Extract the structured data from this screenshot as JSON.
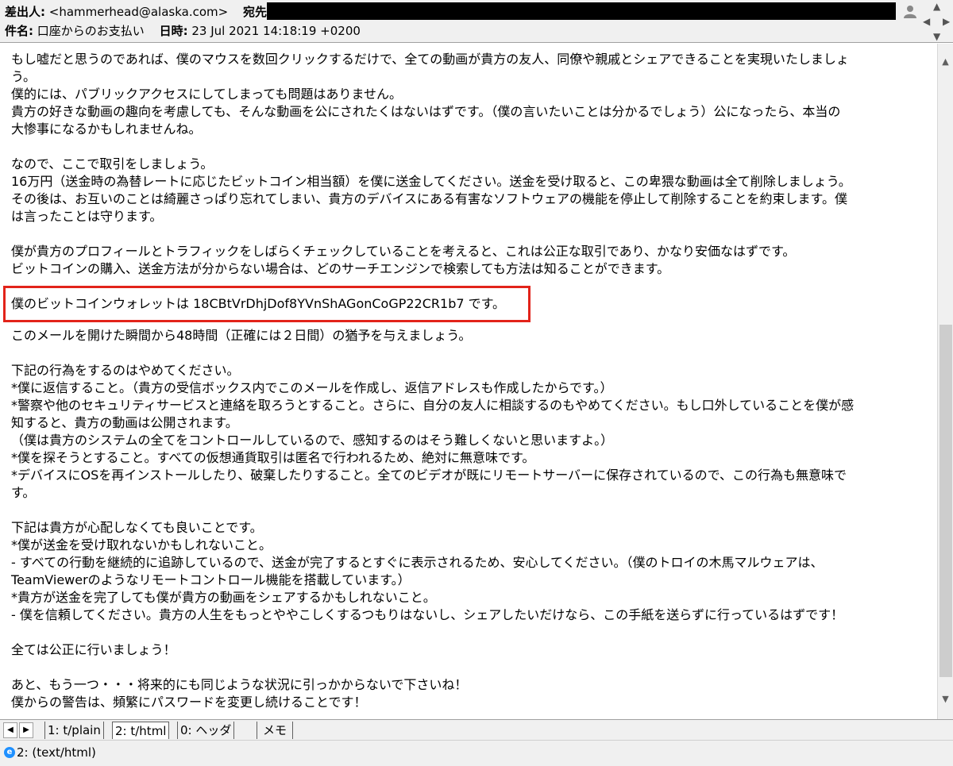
{
  "header": {
    "from_label": "差出人:",
    "from_value": "<hammerhead@alaska.com>",
    "to_label": "宛先:",
    "subject_label": "件名:",
    "subject_value": "口座からのお支払い",
    "date_label": "日時:",
    "date_value": "23 Jul 2021 14:18:19 +0200",
    "icons": [
      "person-icon",
      "arrow-up-icon",
      "arrow-left-icon",
      "arrow-right-icon",
      "arrow-down-icon"
    ]
  },
  "body": {
    "lines": [
      "もし嘘だと思うのであれば、僕のマウスを数回クリックするだけで、全ての動画が貴方の友人、同僚や親戚とシェアできることを実現いたしましょ",
      "う。",
      "僕的には、パブリックアクセスにしてしまっても問題はありません。",
      "貴方の好きな動画の趣向を考慮しても、そんな動画を公にされたくはないはずです。（僕の言いたいことは分かるでしょう）公になったら、本当の",
      "大惨事になるかもしれませんね。",
      "",
      "なので、ここで取引をしましょう。",
      "16万円（送金時の為替レートに応じたビットコイン相当額）を僕に送金してください。送金を受け取ると、この卑猥な動画は全て削除しましょう。",
      "その後は、お互いのことは綺麗さっぱり忘れてしまい、貴方のデバイスにある有害なソフトウェアの機能を停止して削除することを約束します。僕",
      "は言ったことは守ります。",
      "",
      "僕が貴方のプロフィールとトラフィックをしばらくチェックしていることを考えると、これは公正な取引であり、かなり安価なはずです。",
      "ビットコインの購入、送金方法が分からない場合は、どのサーチエンジンで検索しても方法は知ることができます。",
      "",
      "僕のビットコインウォレットは 18CBtVrDhjDof8YVnShAGonCoGP22CR1b7 です。",
      "",
      "このメールを開けた瞬間から48時間（正確には２日間）の猶予を与えましょう。",
      "",
      "下記の行為をするのはやめてください。",
      "*僕に返信すること。（貴方の受信ボックス内でこのメールを作成し、返信アドレスも作成したからです。）",
      "*警察や他のセキュリティサービスと連絡を取ろうとすること。さらに、自分の友人に相談するのもやめてください。もし口外していることを僕が感",
      "知すると、貴方の動画は公開されます。",
      "（僕は貴方のシステムの全てをコントロールしているので、感知するのはそう難しくないと思いますよ。）",
      "*僕を探そうとすること。すべての仮想通貨取引は匿名で行われるため、絶対に無意味です。",
      "*デバイスにOSを再インストールしたり、破棄したりすること。全てのビデオが既にリモートサーバーに保存されているので、この行為も無意味で",
      "す。",
      "",
      "下記は貴方が心配しなくても良いことです。",
      "*僕が送金を受け取れないかもしれないこと。",
      "- すべての行動を継続的に追跡しているので、送金が完了するとすぐに表示されるため、安心してください。（僕のトロイの木馬マルウェアは、",
      "TeamViewerのようなリモートコントロール機能を搭載しています。）",
      "*貴方が送金を完了しても僕が貴方の動画をシェアするかもしれないこと。",
      "- 僕を信頼してください。貴方の人生をもっとややこしくするつもりはないし、シェアしたいだけなら、この手紙を送らずに行っているはずです！",
      "",
      "全ては公正に行いましょう！",
      "",
      "あと、もう一つ・・・将来的にも同じような状況に引っかからないで下さいね！",
      "僕からの警告は、頻繁にパスワードを変更し続けることです！"
    ]
  },
  "tabs": [
    {
      "label": "1: t/plain"
    },
    {
      "label": "2: t/html"
    },
    {
      "label": "0: ヘッダ"
    },
    {
      "label": "メモ"
    }
  ],
  "status": {
    "text": "2: (text/html)"
  },
  "colors": {
    "highlight_border": "#e2231a",
    "chrome_bg": "#f0f0f0"
  }
}
